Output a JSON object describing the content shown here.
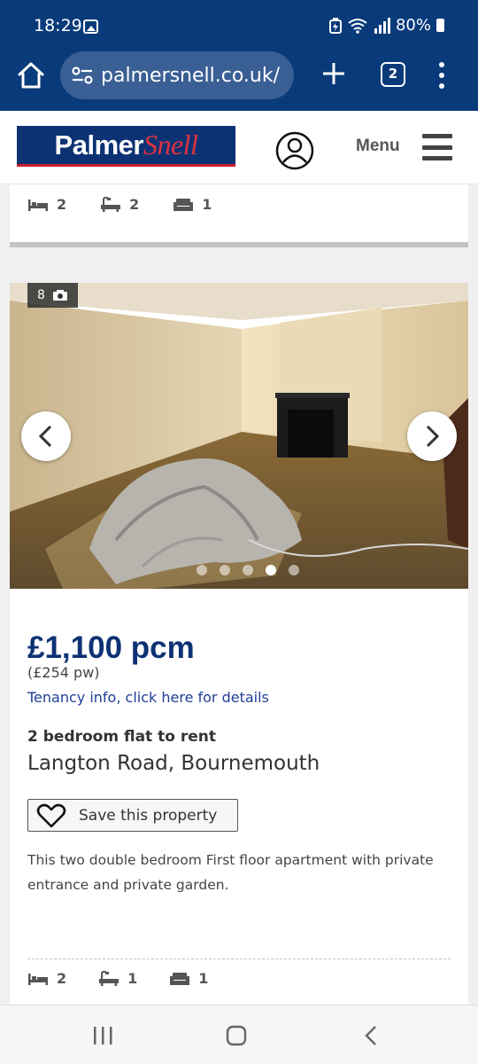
{
  "status": {
    "time": "18:29",
    "battery": "80%"
  },
  "browser": {
    "url": "palmersnell.co.uk/",
    "tab_count": "2"
  },
  "header": {
    "logo_part1": "Palmer",
    "logo_part2": "Snell",
    "menu_label": "Menu"
  },
  "previous_listing": {
    "beds": "2",
    "baths": "2",
    "receptions": "1"
  },
  "listing": {
    "photo_count": "8",
    "carousel": {
      "dots": 5,
      "active_index": 3
    },
    "price": "£1,100 pcm",
    "price_weekly": "(£254 pw)",
    "tenancy_link": "Tenancy info, click here for details",
    "type": "2 bedroom flat to rent",
    "address": "Langton Road, Bournemouth",
    "save_label": "Save this property",
    "description": "This two double bedroom First floor apartment with private entrance and private garden.",
    "beds": "2",
    "baths": "1",
    "receptions": "1"
  },
  "colors": {
    "brand_navy": "#0d3274",
    "status_bar": "#093a7a",
    "logo_red": "#e03340",
    "link": "#1f3e95"
  }
}
